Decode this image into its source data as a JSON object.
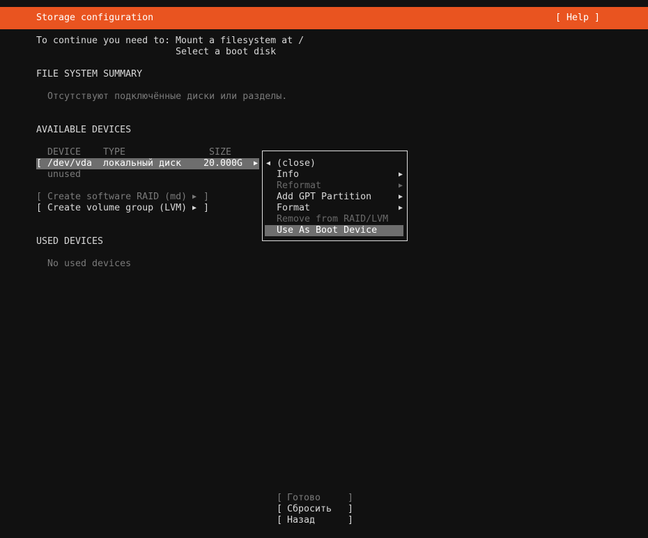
{
  "header": {
    "title": "Storage configuration",
    "help": "[ Help ]"
  },
  "requirements": {
    "prefix": "To continue you need to:",
    "items": [
      "Mount a filesystem at /",
      "Select a boot disk"
    ]
  },
  "fs_summary": {
    "heading": "FILE SYSTEM SUMMARY",
    "empty_text": "Отсутствуют подключённые диски или разделы."
  },
  "available": {
    "heading": "AVAILABLE DEVICES",
    "columns": {
      "device": "DEVICE",
      "type": "TYPE",
      "size": "SIZE"
    },
    "device": {
      "name": "/dev/vda",
      "type": "локальный диск",
      "size": "20.000G",
      "status": "unused"
    },
    "raid_action": "Create software RAID (md)",
    "lvm_action": "Create volume group (LVM)"
  },
  "used": {
    "heading": "USED DEVICES",
    "empty_text": "No used devices"
  },
  "menu": {
    "items": [
      {
        "label": "(close)",
        "enabled": true,
        "submenu": false
      },
      {
        "label": "Info",
        "enabled": true,
        "submenu": true
      },
      {
        "label": "Reformat",
        "enabled": false,
        "submenu": true
      },
      {
        "label": "Add GPT Partition",
        "enabled": true,
        "submenu": true
      },
      {
        "label": "Format",
        "enabled": true,
        "submenu": true
      },
      {
        "label": "Remove from RAID/LVM",
        "enabled": false,
        "submenu": false
      },
      {
        "label": "Use As Boot Device",
        "enabled": true,
        "submenu": false,
        "highlighted": true
      }
    ]
  },
  "footer": {
    "done": "Готово",
    "reset": "Сбросить",
    "back": "Назад"
  },
  "colors": {
    "accent": "#e95420",
    "background": "#111111",
    "selection": "#6e6e6e"
  }
}
